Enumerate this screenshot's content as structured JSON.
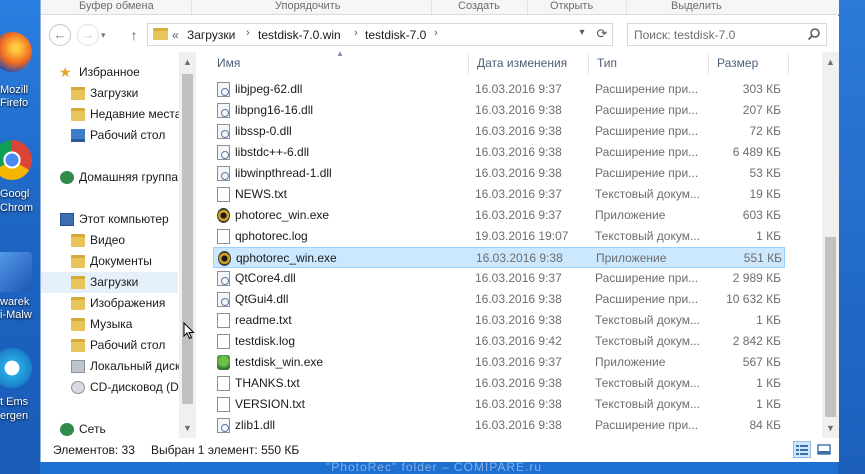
{
  "ribbon": {
    "groups": [
      "Буфер обмена",
      "Упорядочить",
      "Создать",
      "Открыть",
      "Выделить"
    ]
  },
  "nav": {
    "back_icon": "back-arrow-icon",
    "forward_icon": "forward-arrow-icon",
    "up_icon": "up-arrow-icon",
    "breadcrumb": {
      "overflow": "«",
      "items": [
        "Загрузки",
        "testdisk-7.0.win",
        "testdisk-7.0"
      ]
    },
    "search": {
      "placeholder": "Поиск: testdisk-7.0"
    }
  },
  "desktop": {
    "icons": [
      {
        "label1": "Mozill",
        "label2": "Firefo",
        "color": "#e86a1f"
      },
      {
        "label1": "Googl",
        "label2": "Chrom",
        "color": "#3b9b47"
      },
      {
        "label1": "warek",
        "label2": "i-Malw",
        "color": "#2d6fc9"
      },
      {
        "label1": "t Ems",
        "label2": "ergen",
        "color": "#1ba1e2"
      }
    ]
  },
  "navpane": {
    "items": [
      {
        "label": "Избранное",
        "icon": "star-icon"
      },
      {
        "label": "Загрузки",
        "icon": "downloads-folder-icon"
      },
      {
        "label": "Недавние места",
        "icon": "recent-places-icon"
      },
      {
        "label": "Рабочий стол",
        "icon": "desktop-icon"
      },
      {
        "label": "Домашняя группа",
        "icon": "homegroup-icon"
      },
      {
        "label": "Этот компьютер",
        "icon": "computer-icon"
      },
      {
        "label": "Видео",
        "icon": "folder-icon"
      },
      {
        "label": "Документы",
        "icon": "folder-icon"
      },
      {
        "label": "Загрузки",
        "icon": "downloads-folder-icon"
      },
      {
        "label": "Изображения",
        "icon": "folder-icon"
      },
      {
        "label": "Музыка",
        "icon": "folder-icon"
      },
      {
        "label": "Рабочий стол",
        "icon": "folder-icon"
      },
      {
        "label": "Локальный диск",
        "icon": "local-disk-icon"
      },
      {
        "label": "CD-дисковод (D:",
        "icon": "cd-drive-icon"
      },
      {
        "label": "Сеть",
        "icon": "network-icon"
      }
    ]
  },
  "columns": {
    "name": "Имя",
    "date": "Дата изменения",
    "type": "Тип",
    "size": "Размер"
  },
  "files": [
    {
      "name": "libjpeg-62.dll",
      "date": "16.03.2016 9:37",
      "type": "Расширение при...",
      "size": "303 КБ",
      "kind": "dll"
    },
    {
      "name": "libpng16-16.dll",
      "date": "16.03.2016 9:38",
      "type": "Расширение при...",
      "size": "207 КБ",
      "kind": "dll"
    },
    {
      "name": "libssp-0.dll",
      "date": "16.03.2016 9:38",
      "type": "Расширение при...",
      "size": "72 КБ",
      "kind": "dll"
    },
    {
      "name": "libstdc++-6.dll",
      "date": "16.03.2016 9:38",
      "type": "Расширение при...",
      "size": "6 489 КБ",
      "kind": "dll"
    },
    {
      "name": "libwinpthread-1.dll",
      "date": "16.03.2016 9:38",
      "type": "Расширение при...",
      "size": "53 КБ",
      "kind": "dll"
    },
    {
      "name": "NEWS.txt",
      "date": "16.03.2016 9:37",
      "type": "Текстовый докум...",
      "size": "19 КБ",
      "kind": "txt"
    },
    {
      "name": "photorec_win.exe",
      "date": "16.03.2016 9:37",
      "type": "Приложение",
      "size": "603 КБ",
      "kind": "exe"
    },
    {
      "name": "qphotorec.log",
      "date": "19.03.2016 19:07",
      "type": "Текстовый докум...",
      "size": "1 КБ",
      "kind": "txt"
    },
    {
      "name": "qphotorec_win.exe",
      "date": "16.03.2016 9:38",
      "type": "Приложение",
      "size": "551 КБ",
      "kind": "exe"
    },
    {
      "name": "QtCore4.dll",
      "date": "16.03.2016 9:37",
      "type": "Расширение при...",
      "size": "2 989 КБ",
      "kind": "dll"
    },
    {
      "name": "QtGui4.dll",
      "date": "16.03.2016 9:38",
      "type": "Расширение при...",
      "size": "10 632 КБ",
      "kind": "dll"
    },
    {
      "name": "readme.txt",
      "date": "16.03.2016 9:38",
      "type": "Текстовый докум...",
      "size": "1 КБ",
      "kind": "txt"
    },
    {
      "name": "testdisk.log",
      "date": "16.03.2016 9:42",
      "type": "Текстовый докум...",
      "size": "2 842 КБ",
      "kind": "txt"
    },
    {
      "name": "testdisk_win.exe",
      "date": "16.03.2016 9:37",
      "type": "Приложение",
      "size": "567 КБ",
      "kind": "exe2"
    },
    {
      "name": "THANKS.txt",
      "date": "16.03.2016 9:38",
      "type": "Текстовый докум...",
      "size": "1 КБ",
      "kind": "txt"
    },
    {
      "name": "VERSION.txt",
      "date": "16.03.2016 9:38",
      "type": "Текстовый докум...",
      "size": "1 КБ",
      "kind": "txt"
    },
    {
      "name": "zlib1.dll",
      "date": "16.03.2016 9:38",
      "type": "Расширение при...",
      "size": "84 КБ",
      "kind": "dll"
    }
  ],
  "selected_file": "qphotorec_win.exe",
  "status": {
    "count": "Элементов: 33",
    "selection": "Выбран 1 элемент: 550 КБ"
  },
  "watermark": "\"PhotoRec\" folder – COMIPARE.ru",
  "colors": {
    "selection_bg": "#cce8ff",
    "selection_border": "#99d1ff",
    "desktop_blue": "#1e6fd2"
  }
}
